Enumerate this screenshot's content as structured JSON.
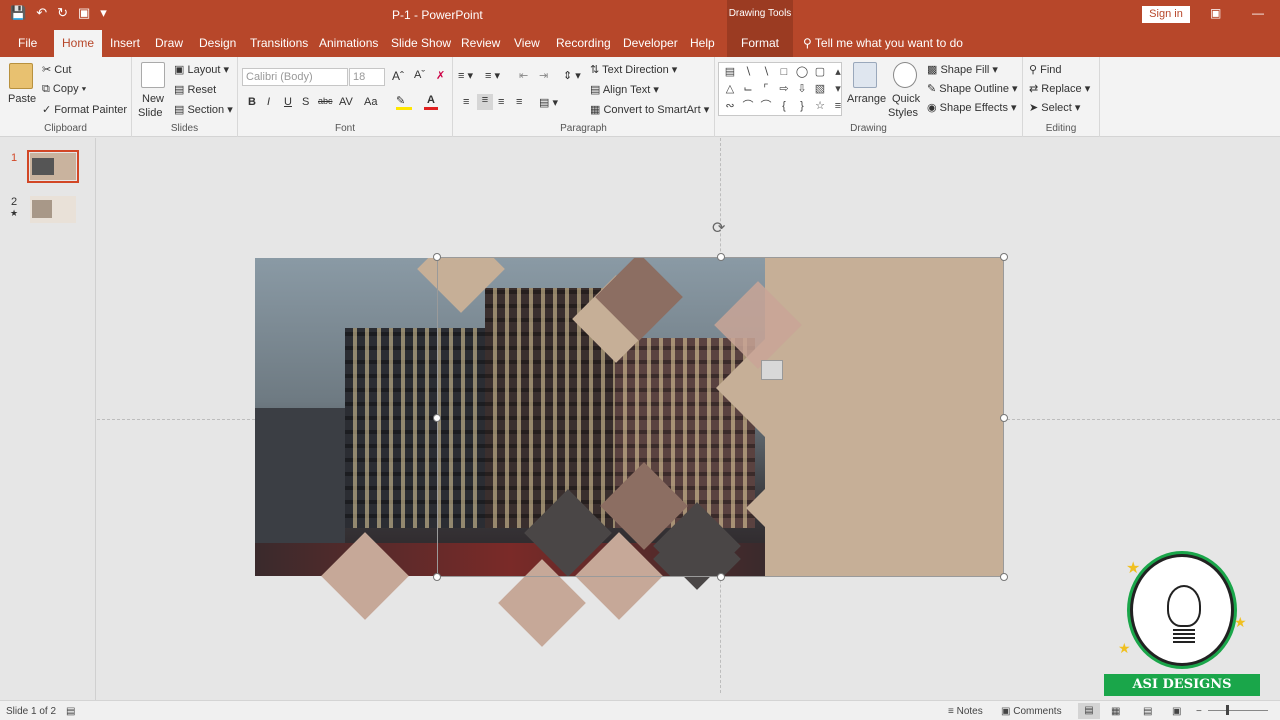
{
  "titlebar": {
    "title": "P-1  -  PowerPoint",
    "context_tab": "Drawing Tools",
    "signin_label": "Sign in",
    "qat_icons": [
      "save-icon",
      "undo-icon",
      "redo-icon",
      "present-icon",
      "customize-icon"
    ]
  },
  "tabs": [
    "File",
    "Home",
    "Insert",
    "Draw",
    "Design",
    "Transitions",
    "Animations",
    "Slide Show",
    "Review",
    "View",
    "Recording",
    "Developer",
    "Help",
    "Format"
  ],
  "tell_me": "Tell me what you want to do",
  "ribbon": {
    "clipboard": {
      "paste": "Paste",
      "cut": "Cut",
      "copy": "Copy",
      "format_painter": "Format Painter",
      "label": "Clipboard"
    },
    "slides": {
      "new_slide_1": "New",
      "new_slide_2": "Slide",
      "layout": "Layout",
      "reset": "Reset",
      "section": "Section",
      "label": "Slides"
    },
    "font": {
      "name": "Calibri (Body)",
      "size": "18",
      "bold": "B",
      "italic": "I",
      "underline": "U",
      "shadow": "S",
      "strike": "abc",
      "spacing": "AV",
      "case": "Aa",
      "label": "Font"
    },
    "paragraph": {
      "text_direction": "Text Direction",
      "align_text": "Align Text",
      "convert_smartart": "Convert to SmartArt",
      "label": "Paragraph"
    },
    "drawing": {
      "arrange": "Arrange",
      "quick_styles_1": "Quick",
      "quick_styles_2": "Styles",
      "shape_fill": "Shape Fill",
      "shape_outline": "Shape Outline",
      "shape_effects": "Shape Effects",
      "label": "Drawing"
    },
    "editing": {
      "find": "Find",
      "replace": "Replace",
      "select": "Select",
      "label": "Editing"
    }
  },
  "slide_panel": {
    "slide1_num": "1",
    "slide2_num": "2"
  },
  "status": {
    "slide_info": "Slide 1 of 2",
    "notes": "Notes",
    "comments": "Comments"
  },
  "logo": {
    "text": "ASI DESIGNS"
  },
  "colors": {
    "accent": "#b7472a",
    "slide_bg": "#c6af97",
    "diamond_dark": "#4a4646",
    "diamond_mid": "#8c6e62",
    "diamond_light": "#c7a998"
  }
}
